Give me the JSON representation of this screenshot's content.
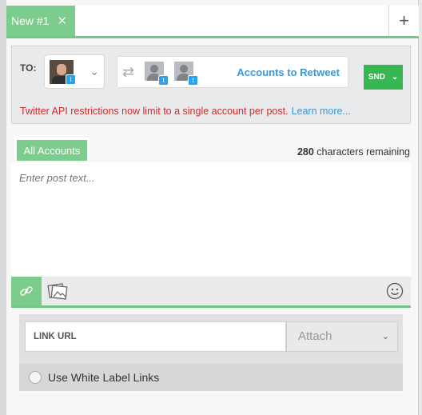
{
  "tabs": [
    {
      "label": "New #1",
      "close": "✕"
    }
  ],
  "add_tab": "+",
  "to_label": "TO:",
  "retweet": {
    "label": "Accounts to Retweet"
  },
  "send": {
    "label": "SND",
    "chevron": "⌄"
  },
  "api_note": {
    "text": "Twitter API restrictions now limit to a single account per post.",
    "link": "Learn more..."
  },
  "editor": {
    "accounts_tab": "All Accounts",
    "chars_remaining": "280",
    "chars_suffix": "characters remaining",
    "placeholder": "Enter post text..."
  },
  "link_panel": {
    "url_label": "LINK URL",
    "attach": "Attach",
    "white_label": "Use White Label Links"
  },
  "colors": {
    "accent": "#7ccc8d",
    "send": "#37b751",
    "warning": "#cc2d2d",
    "link": "#3d96d2"
  }
}
